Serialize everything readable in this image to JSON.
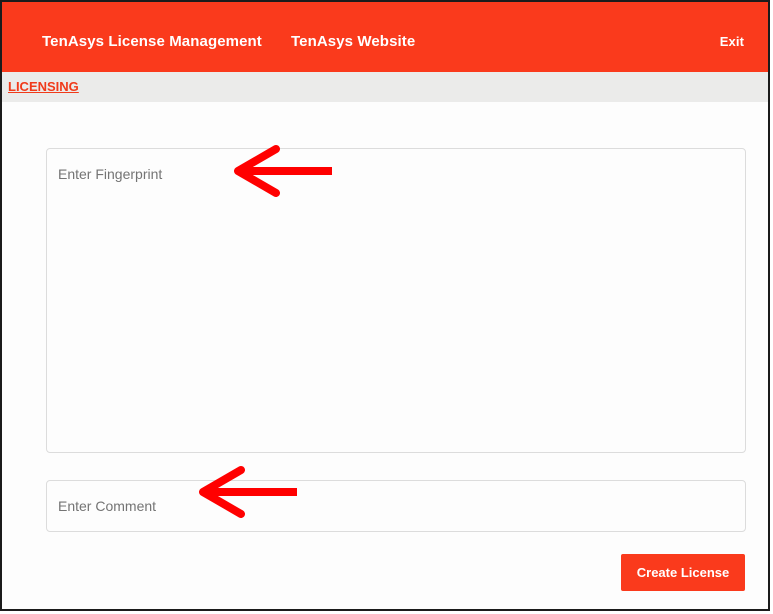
{
  "navbar": {
    "brand_label": "TenAsys License Management",
    "website_label": "TenAsys Website",
    "exit_label": "Exit",
    "background_color": "#fa3a1c"
  },
  "subnav": {
    "licensing_label": "LICENSING"
  },
  "form": {
    "fingerprint": {
      "placeholder": "Enter Fingerprint",
      "value": ""
    },
    "comment": {
      "placeholder": "Enter Comment",
      "value": ""
    },
    "submit_label": "Create License"
  },
  "annotations": {
    "arrow_color": "#ff0000",
    "arrow_icon": "left-arrow-icon"
  }
}
